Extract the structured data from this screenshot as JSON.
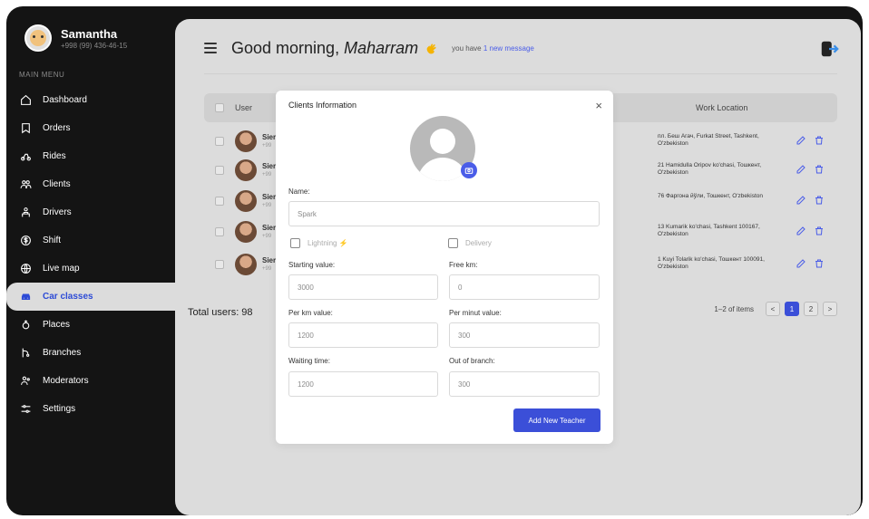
{
  "profile": {
    "name": "Samantha",
    "phone": "+998 (99) 436-46-15"
  },
  "sidebar": {
    "section_label": "MAIN MENU",
    "items": [
      {
        "label": "Dashboard",
        "icon": "home-icon"
      },
      {
        "label": "Orders",
        "icon": "bookmark-icon"
      },
      {
        "label": "Rides",
        "icon": "rides-icon"
      },
      {
        "label": "Clients",
        "icon": "users-icon"
      },
      {
        "label": "Drivers",
        "icon": "driver-icon"
      },
      {
        "label": "Shift",
        "icon": "dollar-icon"
      },
      {
        "label": "Live map",
        "icon": "globe-icon"
      },
      {
        "label": "Car classes",
        "icon": "car-icon",
        "active": true
      },
      {
        "label": "Places",
        "icon": "places-icon"
      },
      {
        "label": "Branches",
        "icon": "branch-icon"
      },
      {
        "label": "Moderators",
        "icon": "moderators-icon"
      },
      {
        "label": "Settings",
        "icon": "sliders-icon"
      }
    ]
  },
  "header": {
    "greeting": "Good morning,",
    "name": "Maharram",
    "message_prefix": "you have",
    "message_link": "1 new message"
  },
  "table": {
    "col_user": "User",
    "col_work": "Work Location",
    "rows": [
      {
        "name": "Sier",
        "phone": "+99",
        "location": "пл. Беш Агач, Furkat Street, Tashkent, O'zbekiston"
      },
      {
        "name": "Sier",
        "phone": "+99",
        "location": "21 Hamidulla Oripov ko'chasi, Тошкент, O'zbekiston"
      },
      {
        "name": "Sier",
        "phone": "+99",
        "location": "76 Фаргона йўли, Тошкент, O'zbekiston"
      },
      {
        "name": "Sier",
        "phone": "+99",
        "location": "13 Kumarik ko'chasi, Tashkent 100167, O'zbekiston"
      },
      {
        "name": "Sier",
        "phone": "+99",
        "location": "1 Kuyi Tolarik ko'chasi, Тошкент 100091, O'zbekiston"
      }
    ]
  },
  "footer": {
    "total": "Total users: 98",
    "pager_info": "1–2 of items",
    "prev": "<",
    "page1": "1",
    "page2": "2",
    "next": ">"
  },
  "modal": {
    "title": "Clients Information",
    "close": "×",
    "name_label": "Name:",
    "name_value": "Spark",
    "lightning_label": "Lightning",
    "lightning_bolt": "⚡",
    "delivery_label": "Delivery",
    "starting_label": "Starting value:",
    "starting_value": "3000",
    "freekm_label": "Free km:",
    "freekm_value": "0",
    "perkm_label": "Per km value:",
    "perkm_value": "1200",
    "perminut_label": "Per minut value:",
    "perminut_value": "300",
    "waiting_label": "Waiting time:",
    "waiting_value": "1200",
    "outbranch_label": "Out of branch:",
    "outbranch_value": "300",
    "submit": "Add New Teacher"
  },
  "colors": {
    "accent": "#3b4fd8",
    "sidebar_bg": "#141414",
    "panel_bg": "#dcdcdc"
  }
}
